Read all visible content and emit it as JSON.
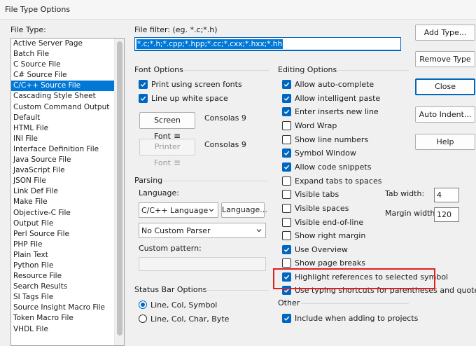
{
  "window": {
    "title": "File Type Options"
  },
  "file_type": {
    "label": "File Type:",
    "items": [
      "Active Server Page",
      "Batch File",
      "C Source File",
      "C# Source File",
      "C/C++ Source File",
      "Cascading Style Sheet",
      "Custom Command Output",
      "Default",
      "HTML File",
      "INI File",
      "Interface Definition File",
      "Java Source File",
      "JavaScript File",
      "JSON File",
      "Link Def File",
      "Make File",
      "Objective-C File",
      "Output File",
      "Perl Source File",
      "PHP File",
      "Plain Text",
      "Python File",
      "Resource File",
      "Search Results",
      "SI Tags File",
      "Source Insight Macro File",
      "Token Macro File",
      "VHDL File"
    ],
    "selected": "C/C++ Source File"
  },
  "file_filter": {
    "label": "File filter: (eg. *.c;*.h)",
    "value": "*.c;*.h;*.cpp;*.hpp;*.cc;*.cxx;*.hxx;*.hh"
  },
  "buttons": {
    "add_type": "Add Type...",
    "remove_type": "Remove Type",
    "close": "Close",
    "auto_indent": "Auto Indent...",
    "help": "Help"
  },
  "font_options": {
    "title": "Font Options",
    "print_screen_fonts": "Print using screen fonts",
    "line_up_white_space": "Line up white space",
    "screen_font_button": "Screen Font",
    "screen_font_value": "Consolas 9",
    "printer_font_button": "Printer Font",
    "printer_font_value": "Consolas 9"
  },
  "parsing": {
    "title": "Parsing",
    "language_label": "Language:",
    "language_value": "C/C++ Language",
    "language_button": "Language...",
    "parser_value": "No Custom Parser",
    "custom_pattern_label": "Custom pattern:",
    "custom_pattern_value": ""
  },
  "status_bar": {
    "title": "Status Bar Options",
    "option1": "Line, Col, Symbol",
    "option2": "Line, Col, Char, Byte"
  },
  "editing": {
    "title": "Editing Options",
    "auto_complete": "Allow auto-complete",
    "intelligent_paste": "Allow intelligent paste",
    "enter_inserts_new_line": "Enter inserts new line",
    "word_wrap": "Word Wrap",
    "show_line_numbers": "Show line numbers",
    "symbol_window": "Symbol Window",
    "code_snippets": "Allow code snippets",
    "expand_tabs": "Expand tabs to spaces",
    "visible_tabs": "Visible tabs",
    "visible_spaces": "Visible spaces",
    "visible_eol": "Visible end-of-line",
    "show_right_margin": "Show right margin",
    "use_overview": "Use Overview",
    "show_page_breaks": "Show page breaks",
    "highlight_references": "Highlight references to selected symbol",
    "typing_shortcuts": "Use typing shortcuts for parentheses and quotes",
    "tab_width_label": "Tab width:",
    "tab_width_value": "4",
    "margin_width_label": "Margin width:",
    "margin_width_value": "120"
  },
  "other": {
    "title": "Other",
    "include_when_adding": "Include when adding to projects"
  },
  "colors": {
    "accent": "#0067c0",
    "selection": "#0078d7",
    "highlight_border": "#e02020"
  }
}
